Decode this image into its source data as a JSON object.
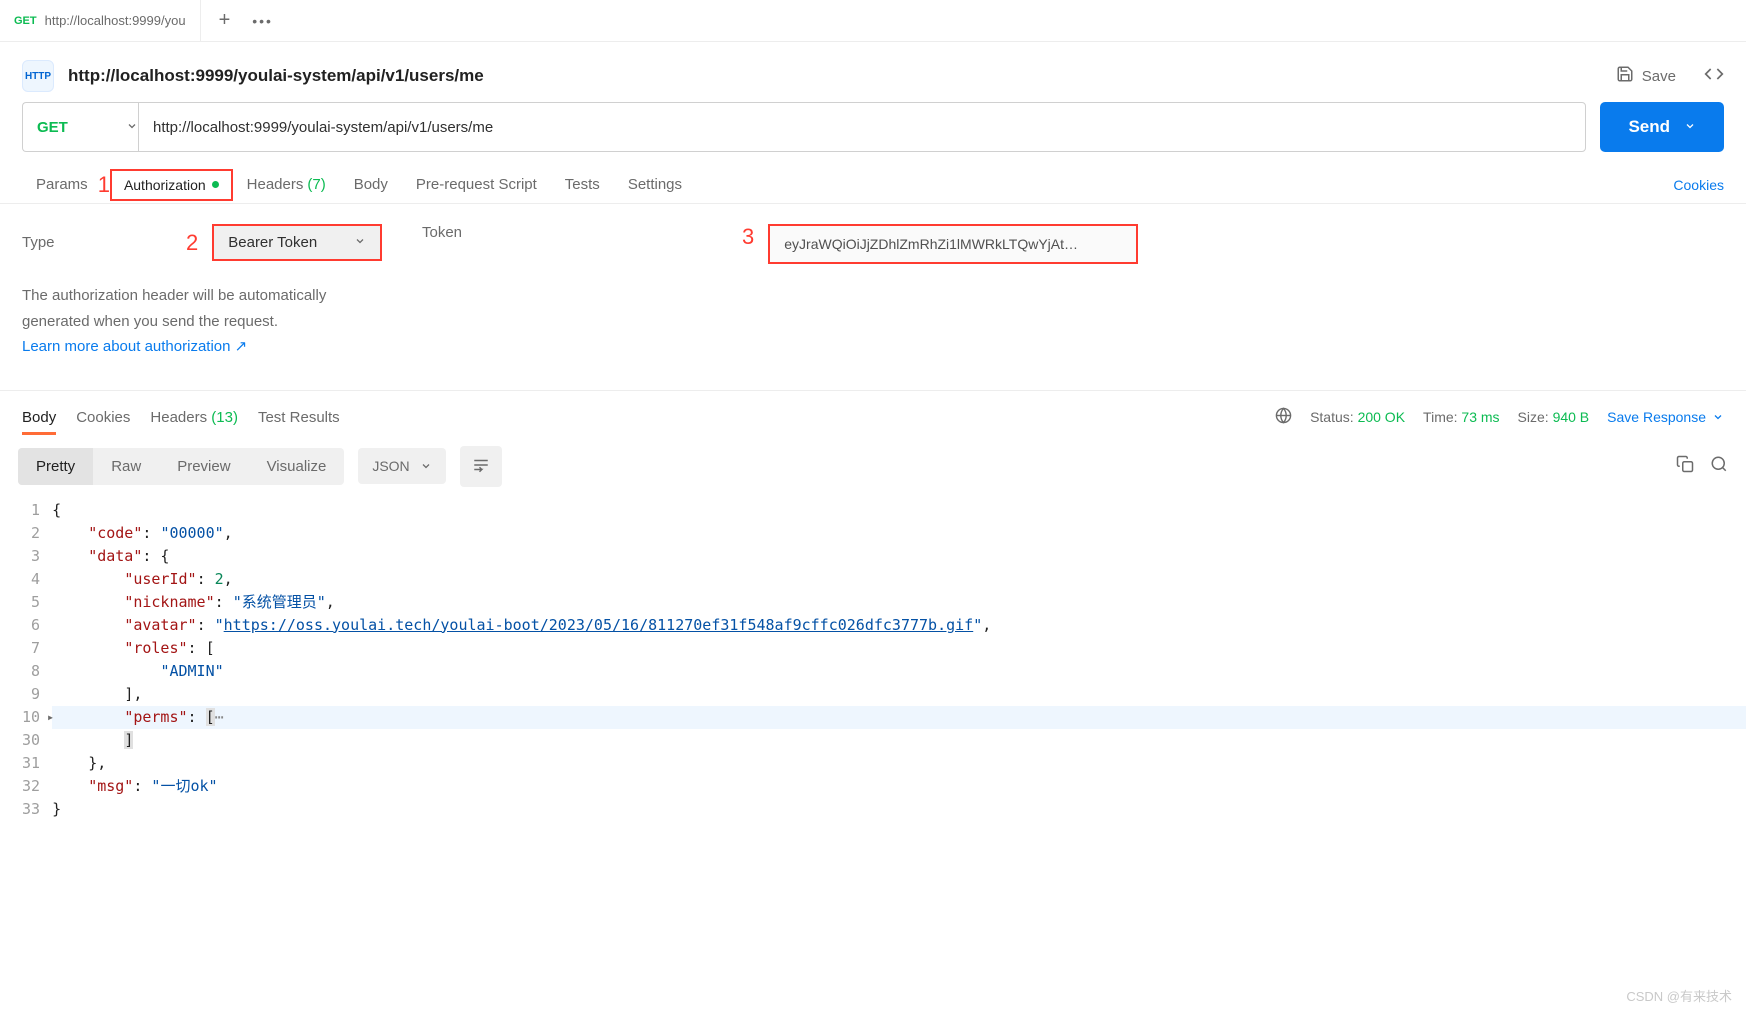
{
  "tab": {
    "method": "GET",
    "title": "http://localhost:9999/you"
  },
  "header": {
    "title": "http://localhost:9999/youlai-system/api/v1/users/me",
    "save": "Save"
  },
  "url": {
    "method": "GET",
    "value": "http://localhost:9999/youlai-system/api/v1/users/me",
    "send": "Send"
  },
  "reqtabs": {
    "params": "Params",
    "auth": "Authorization",
    "headers": "Headers",
    "headers_cnt": "(7)",
    "body": "Body",
    "prereq": "Pre-request Script",
    "tests": "Tests",
    "settings": "Settings",
    "cookies": "Cookies"
  },
  "annot": {
    "a1": "1",
    "a2": "2",
    "a3": "3"
  },
  "auth": {
    "type_lbl": "Type",
    "type_val": "Bearer Token",
    "desc1": "The authorization header will be automatically",
    "desc2": "generated when you send the request.",
    "learn": "Learn more about authorization ↗",
    "token_lbl": "Token",
    "token_val": "eyJraWQiOiJjZDhlZmRhZi1lMWRkLTQwYjAt…"
  },
  "resptabs": {
    "body": "Body",
    "cookies": "Cookies",
    "headers": "Headers",
    "headers_cnt": "(13)",
    "tests": "Test Results",
    "status_lbl": "Status:",
    "status_val": "200 OK",
    "time_lbl": "Time:",
    "time_val": "73 ms",
    "size_lbl": "Size:",
    "size_val": "940 B",
    "save": "Save Response"
  },
  "view": {
    "pretty": "Pretty",
    "raw": "Raw",
    "preview": "Preview",
    "visualize": "Visualize",
    "json": "JSON"
  },
  "resp": {
    "code": "00000",
    "userId": 2,
    "nickname": "系统管理员",
    "avatar": "https://oss.youlai.tech/youlai-boot/2023/05/16/811270ef31f548af9cffc026dfc3777b.gif",
    "role": "ADMIN",
    "msg": "一切ok"
  },
  "lines": [
    "1",
    "2",
    "3",
    "4",
    "5",
    "6",
    "7",
    "8",
    "9",
    "10",
    "30",
    "31",
    "32",
    "33"
  ],
  "watermark": "CSDN @有来技术"
}
